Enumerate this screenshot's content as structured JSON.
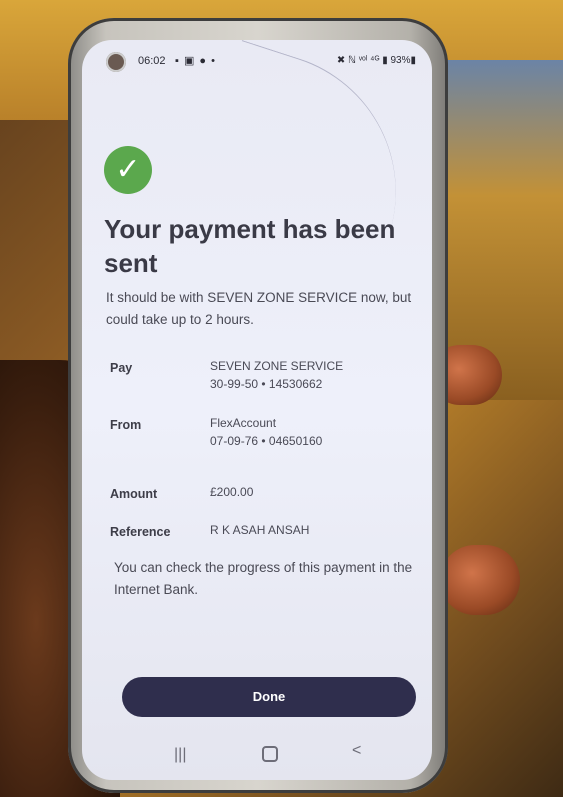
{
  "status_bar": {
    "time": "06:02",
    "left_icons": "▪ ▣ ● •",
    "right_text": "✖ ℕ ᵛᵒˡ ⁴ᴳ ▮ 93%▮"
  },
  "confirmation": {
    "title": "Your payment has been sent",
    "subtitle": "It should be with SEVEN ZONE SERVICE now, but could take up to 2 hours."
  },
  "details": {
    "pay_label": "Pay",
    "pay_name": "SEVEN ZONE SERVICE",
    "pay_account": "30-99-50 • 14530662",
    "from_label": "From",
    "from_name": "FlexAccount",
    "from_account": "07-09-76 • 04650160",
    "amount_label": "Amount",
    "amount_value": "£200.00",
    "reference_label": "Reference",
    "reference_value": "R K ASAH ANSAH"
  },
  "note": "You can check the progress of this payment in the Internet Bank.",
  "actions": {
    "done_label": "Done"
  },
  "nav": {
    "recent": "|||",
    "back": "<"
  },
  "colors": {
    "check_green": "#5ba84d",
    "button_dark": "#2f2e4d"
  }
}
